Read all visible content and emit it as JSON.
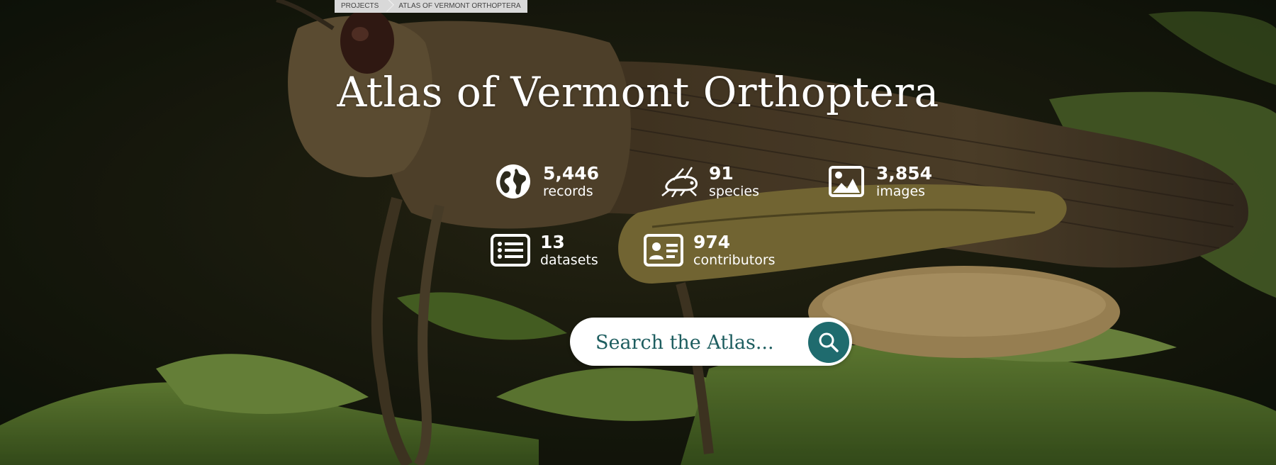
{
  "breadcrumb": [
    "Projects",
    "Atlas of Vermont Orthoptera"
  ],
  "page_title": "Atlas of Vermont Orthoptera",
  "stats": [
    {
      "icon": "globe-icon",
      "value": "5,446",
      "label": "records"
    },
    {
      "icon": "cricket-icon",
      "value": "91",
      "label": "species"
    },
    {
      "icon": "image-icon",
      "value": "3,854",
      "label": "images"
    },
    {
      "icon": "list-icon",
      "value": "13",
      "label": "datasets"
    },
    {
      "icon": "contact-card-icon",
      "value": "974",
      "label": "contributors"
    }
  ],
  "search": {
    "placeholder": "Search the Atlas...",
    "icon": "search-icon"
  },
  "colors": {
    "search_button": "#1f6b6e",
    "search_text": "#1d5d5f"
  }
}
